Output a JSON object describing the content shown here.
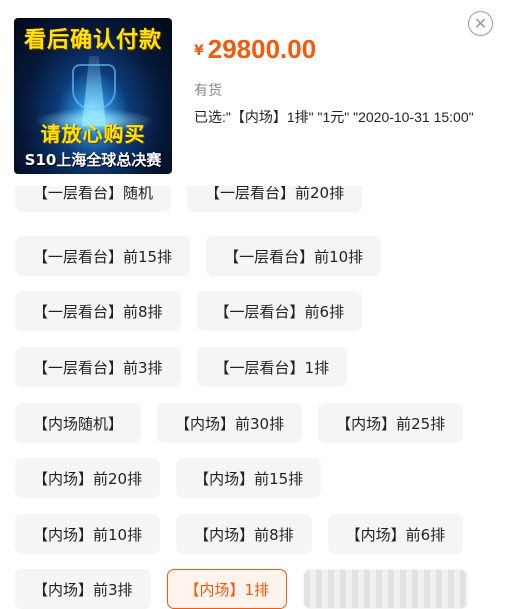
{
  "product": {
    "image_text_top": "看后确认付款",
    "image_text_mid": "请放心购买",
    "image_text_bottom": "S10上海全球总决赛"
  },
  "price": {
    "symbol": "¥",
    "amount": "29800.00"
  },
  "stock_status": "有货",
  "selection": {
    "text": "已选:\"【内场】1排\" \"1元\" \"2020-10-31 15:00\""
  },
  "options": [
    {
      "label": "【一层看台】随机"
    },
    {
      "label": "【一层看台】前20排"
    },
    {
      "label": "【一层看台】前15排"
    },
    {
      "label": "【一层看台】前10排"
    },
    {
      "label": "【一层看台】前8排"
    },
    {
      "label": "【一层看台】前6排"
    },
    {
      "label": "【一层看台】前3排"
    },
    {
      "label": "【一层看台】1排"
    },
    {
      "label": "【内场随机】"
    },
    {
      "label": "【内场】前30排"
    },
    {
      "label": "【内场】前25排"
    },
    {
      "label": "【内场】前20排"
    },
    {
      "label": "【内场】前15排"
    },
    {
      "label": "【内场】前10排"
    },
    {
      "label": "【内场】前8排"
    },
    {
      "label": "【内场】前6排"
    },
    {
      "label": "【内场】前3排"
    },
    {
      "label": "【内场】1排",
      "selected": true
    }
  ],
  "colors": {
    "accent": "#f25a0c",
    "chip_bg": "#f5f5f5",
    "text": "#222222"
  }
}
